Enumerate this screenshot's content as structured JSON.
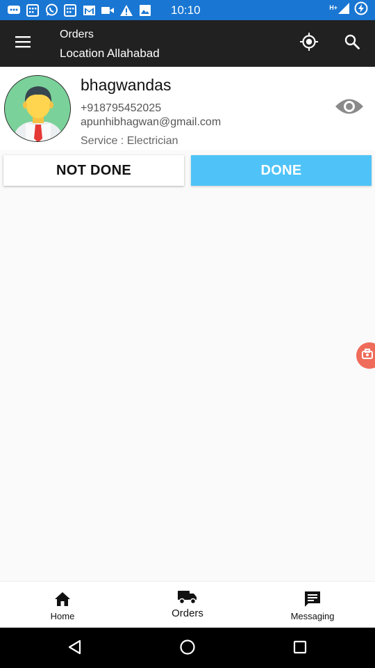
{
  "status_bar": {
    "time": "10:10",
    "network_label": "H+",
    "icons": [
      "chat-icon",
      "calendar-icon",
      "whatsapp-icon",
      "calendar-icon",
      "gmail-icon",
      "video-icon",
      "warning-icon",
      "image-icon"
    ]
  },
  "toolbar": {
    "title": "Orders",
    "subtitle": "Location Allahabad",
    "icons": [
      "menu-icon",
      "my-location-icon",
      "search-icon"
    ]
  },
  "order": {
    "name": "bhagwandas",
    "phone": "+918795452025",
    "email": "apunhibhagwan@gmail.com",
    "service": "Service : Electrician"
  },
  "actions": {
    "not_done": "NOT DONE",
    "done": "DONE"
  },
  "bottom_nav": {
    "items": [
      {
        "label": "Home",
        "icon": "home-icon"
      },
      {
        "label": "Orders",
        "icon": "truck-icon"
      },
      {
        "label": "Messaging",
        "icon": "message-icon"
      }
    ]
  },
  "colors": {
    "status_bar": "#1976d2",
    "toolbar": "#212121",
    "done_button": "#4fc3f7",
    "avatar_bg": "#7bd19a",
    "float_button": "#ef6c5a"
  }
}
